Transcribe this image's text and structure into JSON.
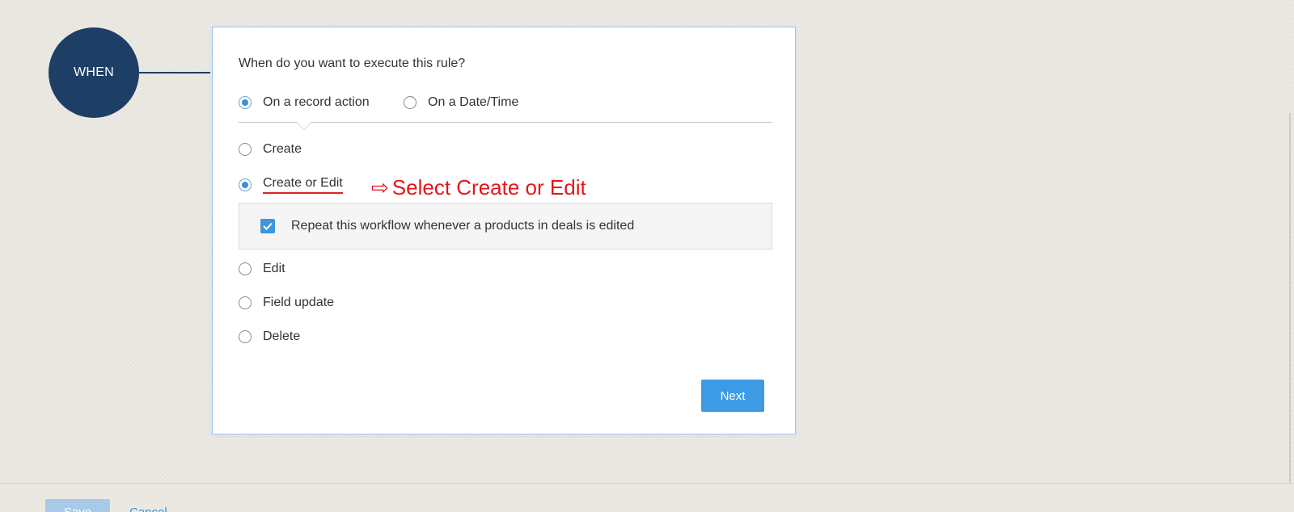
{
  "when_node": {
    "label": "WHEN"
  },
  "rule_card": {
    "question": "When do you want to execute this rule?",
    "trigger_tabs": [
      {
        "label": "On a record action",
        "selected": true
      },
      {
        "label": "On a Date/Time",
        "selected": false
      }
    ],
    "actions": [
      {
        "label": "Create",
        "selected": false
      },
      {
        "label": "Create or Edit",
        "selected": true
      },
      {
        "label": "Edit",
        "selected": false
      },
      {
        "label": "Field update",
        "selected": false
      },
      {
        "label": "Delete",
        "selected": false
      }
    ],
    "repeat_option": {
      "label": "Repeat this workflow whenever a products in deals is edited",
      "checked": true
    },
    "next_label": "Next"
  },
  "annotation": {
    "arrow": "⇨",
    "text": "Select Create or Edit"
  },
  "footer": {
    "save_label": "Save",
    "cancel_label": "Cancel"
  },
  "colors": {
    "accent": "#3d9be6",
    "node": "#1d3f66",
    "annotation": "#e8141b",
    "background": "#ebe8e2"
  }
}
